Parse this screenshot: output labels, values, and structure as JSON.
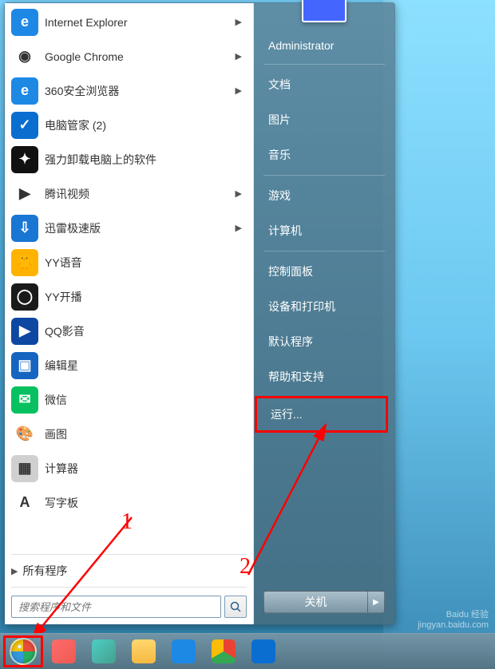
{
  "programs": [
    {
      "label": "Internet Explorer",
      "icon_bg": "#1e88e5",
      "glyph": "e",
      "has_arrow": true
    },
    {
      "label": "Google Chrome",
      "icon_bg": "#fff",
      "glyph": "◉",
      "has_arrow": true
    },
    {
      "label": "360安全浏览器",
      "icon_bg": "#1e88e5",
      "glyph": "e",
      "has_arrow": true
    },
    {
      "label": "电脑管家 (2)",
      "icon_bg": "#0a6ed1",
      "glyph": "✓",
      "has_arrow": false
    },
    {
      "label": "强力卸载电脑上的软件",
      "icon_bg": "#111",
      "glyph": "✦",
      "has_arrow": false
    },
    {
      "label": "腾讯视频",
      "icon_bg": "#fff",
      "glyph": "▶",
      "has_arrow": true
    },
    {
      "label": "迅雷极速版",
      "icon_bg": "#1976d2",
      "glyph": "⇩",
      "has_arrow": true
    },
    {
      "label": "YY语音",
      "icon_bg": "#ffb300",
      "glyph": "🐥",
      "has_arrow": false
    },
    {
      "label": "YY开播",
      "icon_bg": "#1a1a1a",
      "glyph": "◯",
      "has_arrow": false
    },
    {
      "label": "QQ影音",
      "icon_bg": "#0d47a1",
      "glyph": "▶",
      "has_arrow": false
    },
    {
      "label": "编辑星",
      "icon_bg": "#1565c0",
      "glyph": "▣",
      "has_arrow": false
    },
    {
      "label": "微信",
      "icon_bg": "#07c160",
      "glyph": "✉",
      "has_arrow": false
    },
    {
      "label": "画图",
      "icon_bg": "#fff",
      "glyph": "🎨",
      "has_arrow": false
    },
    {
      "label": "计算器",
      "icon_bg": "#d0d0d0",
      "glyph": "▦",
      "has_arrow": false
    },
    {
      "label": "写字板",
      "icon_bg": "#fff",
      "glyph": "A",
      "has_arrow": false
    }
  ],
  "all_programs_label": "所有程序",
  "search": {
    "placeholder": "搜索程序和文件"
  },
  "right_panel": {
    "user": "Administrator",
    "links_top": [
      "文档",
      "图片",
      "音乐"
    ],
    "links_mid": [
      "游戏",
      "计算机"
    ],
    "links_bot": [
      "控制面板",
      "设备和打印机",
      "默认程序",
      "帮助和支持"
    ],
    "run": "运行..."
  },
  "shutdown": {
    "label": "关机"
  },
  "annotations": {
    "one": "1",
    "two": "2"
  },
  "watermark": {
    "line1": "Baidu 经验",
    "line2": "jingyan.baidu.com"
  },
  "taskbar_icons": [
    {
      "name": "app-icon-1",
      "bg": "linear-gradient(135deg,#ff6b6b,#ee5a52)"
    },
    {
      "name": "app-icon-2",
      "bg": "linear-gradient(135deg,#4ecdc4,#44a08d)"
    },
    {
      "name": "folder-icon",
      "bg": "linear-gradient(180deg,#ffd76e,#f5b942)"
    },
    {
      "name": "browser-icon",
      "bg": "#1e88e5"
    },
    {
      "name": "chrome-icon",
      "bg": "conic-gradient(#ea4335 0 120deg,#34a853 120deg 240deg,#fbbc05 240deg)"
    },
    {
      "name": "security-icon",
      "bg": "#0a6ed1"
    }
  ]
}
